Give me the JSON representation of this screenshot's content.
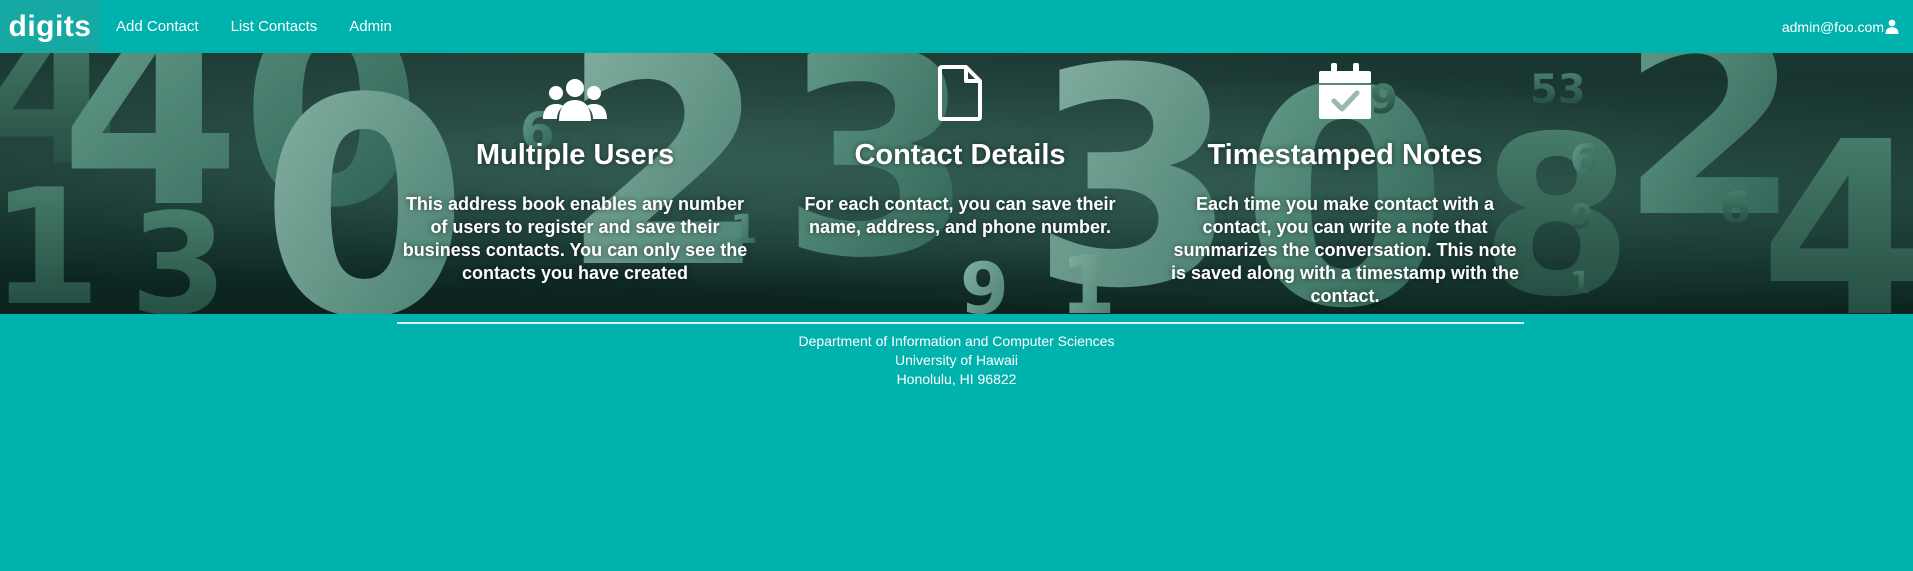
{
  "navbar": {
    "brand": "digits",
    "links": [
      "Add Contact",
      "List Contacts",
      "Admin"
    ],
    "user": "admin@foo.com",
    "user_icon": "user-icon"
  },
  "features": [
    {
      "icon": "users-icon",
      "title": "Multiple Users",
      "text": "This address book enables any number of users to register and save their business contacts. You can only see the contacts you have created"
    },
    {
      "icon": "file-icon",
      "title": "Contact Details",
      "text": "For each contact, you can save their name, address, and phone number."
    },
    {
      "icon": "calendar-check-icon",
      "title": "Timestamped Notes",
      "text": "Each time you make contact with a contact, you can write a note that summarizes the conversation. This note is saved along with a timestamp with the contact."
    }
  ],
  "footer": {
    "lines": [
      "Department of Information and Computer Sciences",
      "University of Hawaii",
      "Honolulu, HI 96822"
    ]
  },
  "colors": {
    "primary": "#00B2AD",
    "brand_bg": "#16A9A4",
    "text": "#FFFFFF"
  }
}
